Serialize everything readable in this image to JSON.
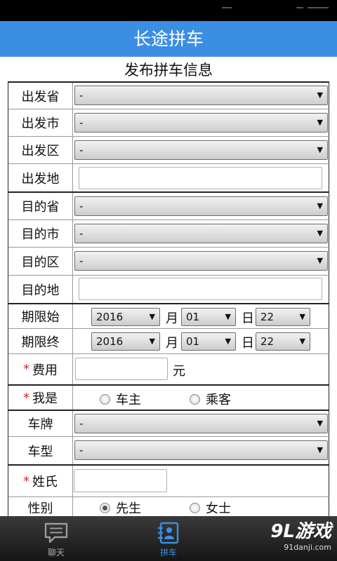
{
  "app_title": "长途拼车",
  "form_title": "发布拼车信息",
  "rows": {
    "dep_province": {
      "label": "出发省",
      "value": "-"
    },
    "dep_city": {
      "label": "出发市",
      "value": "-"
    },
    "dep_district": {
      "label": "出发区",
      "value": "-"
    },
    "dep_place": {
      "label": "出发地",
      "value": ""
    },
    "dst_province": {
      "label": "目的省",
      "value": "-"
    },
    "dst_city": {
      "label": "目的市",
      "value": "-"
    },
    "dst_district": {
      "label": "目的区",
      "value": "-"
    },
    "dst_place": {
      "label": "目的地",
      "value": ""
    },
    "start_date": {
      "label": "期限始",
      "year": "2016",
      "month_unit": "月",
      "month": "01",
      "day_unit": "日",
      "day": "22"
    },
    "end_date": {
      "label": "期限终",
      "year": "2016",
      "month_unit": "月",
      "month": "01",
      "day_unit": "日",
      "day": "22"
    },
    "fee": {
      "required_mark": "*",
      "label": "费用",
      "value": "",
      "unit": "元"
    },
    "role": {
      "required_mark": "*",
      "label": "我是",
      "option_driver": "车主",
      "option_passenger": "乘客",
      "selected": "none"
    },
    "plate": {
      "label": "车牌",
      "value": "-"
    },
    "car_model": {
      "label": "车型",
      "value": "-"
    },
    "surname": {
      "required_mark": "*",
      "label": "姓氏",
      "value": ""
    },
    "gender": {
      "label": "性别",
      "option_male": "先生",
      "option_female": "女士",
      "selected": "先生"
    }
  },
  "tabs": {
    "chat": {
      "label": "聊天",
      "icon": "chat-bubble-icon",
      "active": false
    },
    "carpool": {
      "label": "拼车",
      "icon": "contact-book-icon",
      "active": true,
      "active_color": "#3b8ee3"
    }
  },
  "watermark": {
    "main": "9L游戏",
    "sub": "91danji.com"
  },
  "colors": {
    "title_bar": "#3b8ee3",
    "required": "#e02020",
    "tab_bar": "#1e1e1e"
  }
}
